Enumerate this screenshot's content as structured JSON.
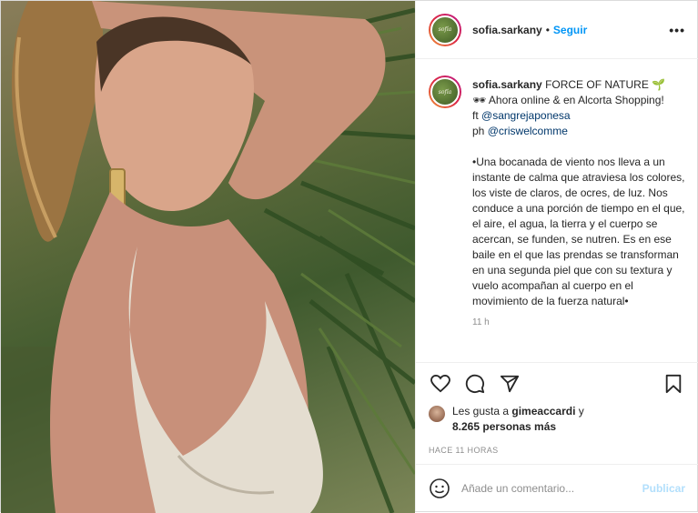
{
  "post": {
    "username": "sofia.sarkany",
    "follow_separator": "•",
    "follow_label": "Seguir",
    "more_label": "•••",
    "avatar_text": "sofía",
    "caption": {
      "username": "sofia.sarkany",
      "line1": "FORCE OF NATURE 🌱",
      "line2": "🕶 Ahora online & en Alcorta Shopping!",
      "ft_prefix": "ft ",
      "ft_mention": "@sangrejaponesa",
      "ph_prefix": "ph ",
      "ph_mention": "@criswelcomme",
      "paragraph": "•Una bocanada de viento nos lleva a un instante de calma que atraviesa los colores, los viste de claros, de ocres, de luz. Nos conduce a una porción de tiempo en el que, el aire, el agua, la tierra y el cuerpo se acercan, se funden, se nutren. Es en ese baile en el que las prendas se transforman en una segunda piel que con su textura y vuelo acompañan al cuerpo en el movimiento de la fuerza natural•"
    },
    "time": "11 h",
    "likes": {
      "prefix": "Les gusta a ",
      "first_user": "gimeaccardi",
      "connector": " y",
      "others": "8.265 personas más"
    },
    "posted_ago": "HACE 11 HORAS",
    "comment": {
      "placeholder": "Añade un comentario...",
      "publish_label": "Publicar"
    },
    "icons": {
      "like": "heart-icon",
      "comment": "comment-icon",
      "share": "share-icon",
      "save": "bookmark-icon",
      "emoji": "emoji-icon"
    },
    "colors": {
      "link_blue": "#0095f6",
      "mention": "#00376b",
      "muted": "#8e8e8e",
      "publish_disabled": "#b2dffc"
    }
  }
}
